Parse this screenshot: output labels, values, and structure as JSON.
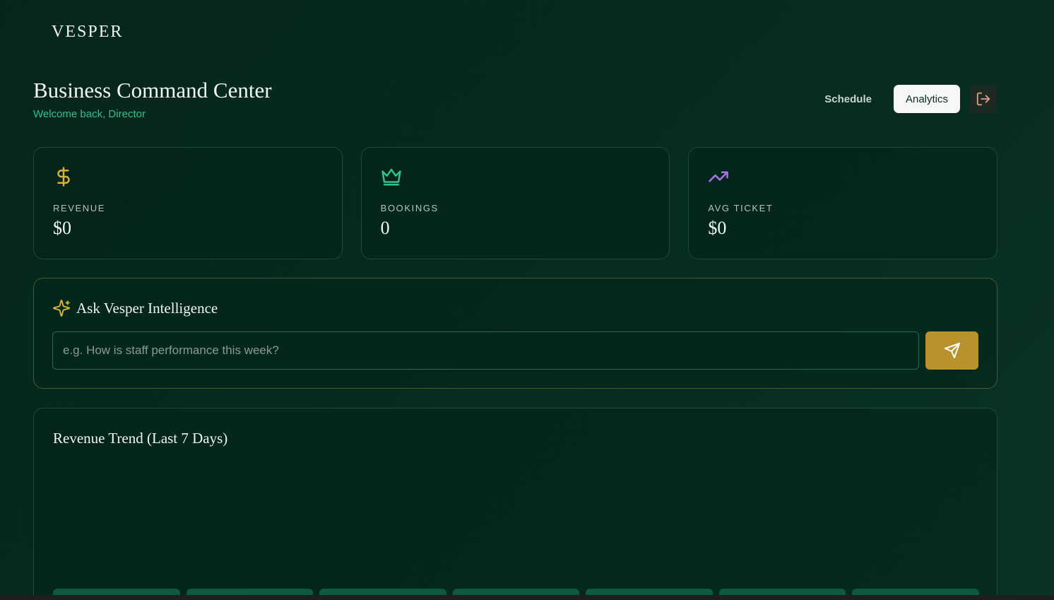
{
  "brand": "VESPER",
  "header": {
    "title": "Business Command Center",
    "subtitle": "Welcome back, Director"
  },
  "nav": {
    "schedule_label": "Schedule",
    "analytics_label": "Analytics",
    "logout_icon": "logout-icon"
  },
  "stats": [
    {
      "icon": "dollar-icon",
      "label": "REVENUE",
      "value": "$0",
      "color": "#d4b13b"
    },
    {
      "icon": "crown-icon",
      "label": "BOOKINGS",
      "value": "0",
      "color": "#35c08a"
    },
    {
      "icon": "trending-up-icon",
      "label": "AVG TICKET",
      "value": "$0",
      "color": "#a775e8"
    }
  ],
  "ask": {
    "title": "Ask Vesper Intelligence",
    "placeholder": "e.g. How is staff performance this week?",
    "icon": "sparkles-icon",
    "send_icon": "send-icon",
    "accent": "#b8922a"
  },
  "trend": {
    "title": "Revenue Trend (Last 7 Days)"
  },
  "chart_data": {
    "type": "bar",
    "title": "Revenue Trend (Last 7 Days)",
    "values": [
      0,
      0,
      0,
      0,
      0,
      0,
      0
    ]
  }
}
